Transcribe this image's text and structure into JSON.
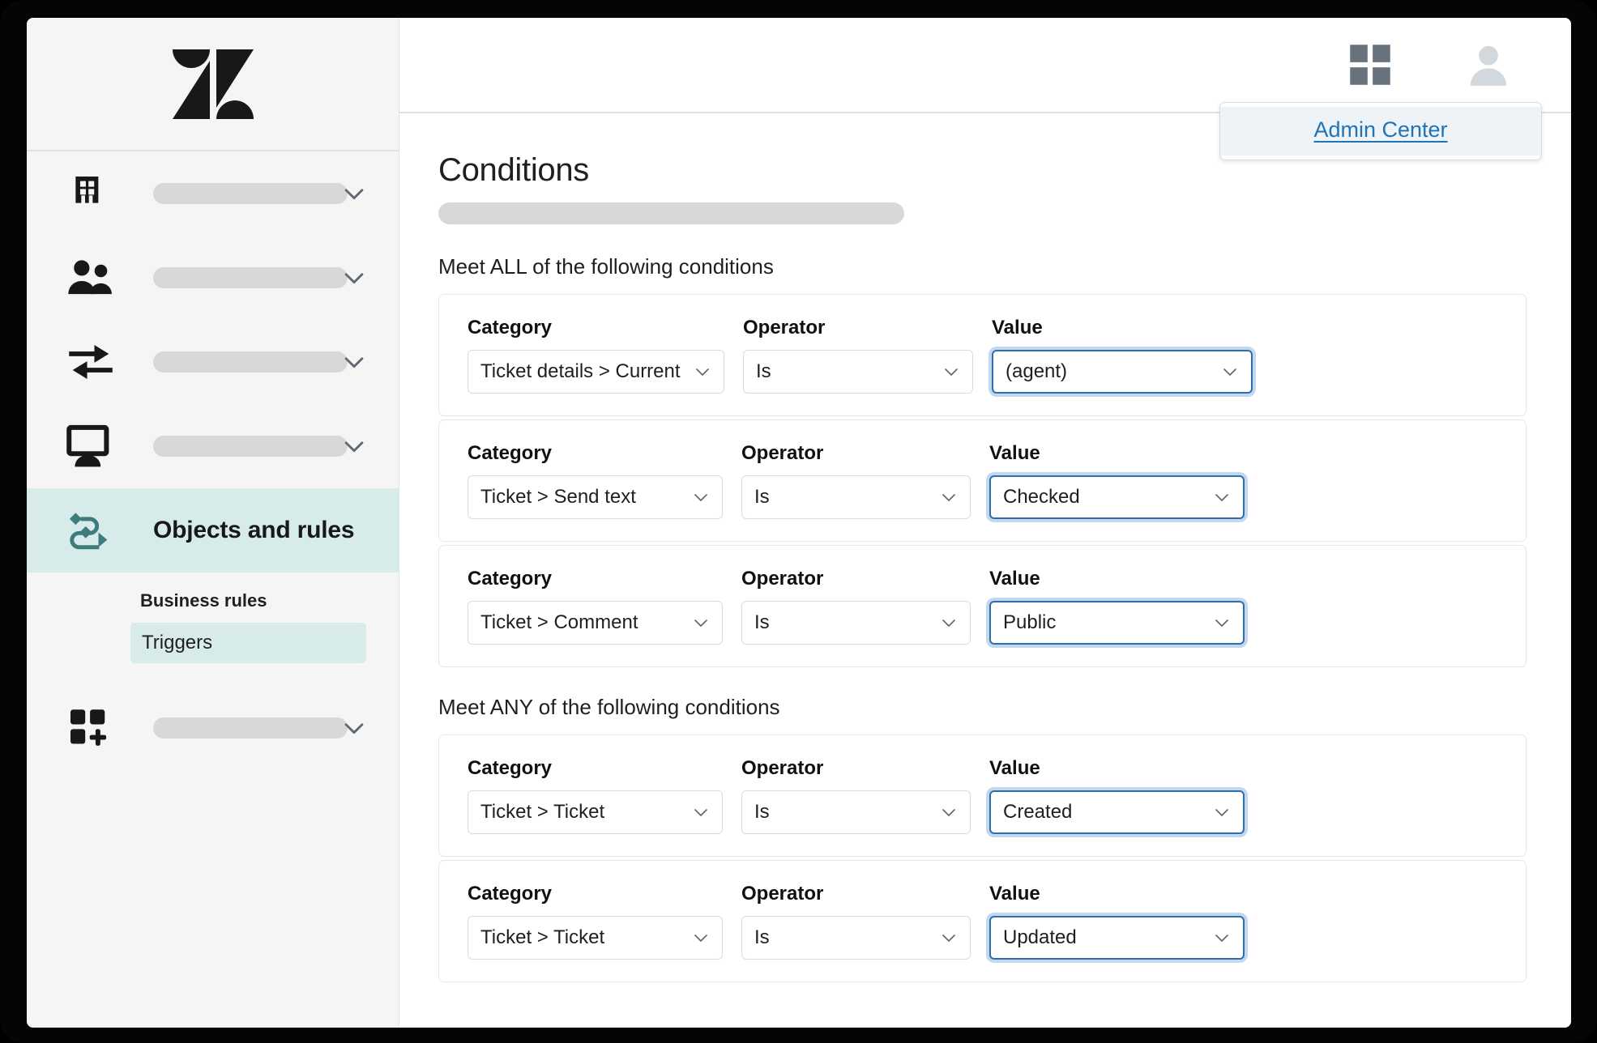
{
  "sidebar": {
    "logo_name": "zendesk-logo",
    "nav_groups": [
      {
        "icon": "building-icon",
        "label": "",
        "chevron": "chevron-down-icon"
      },
      {
        "icon": "people-icon",
        "label": "",
        "chevron": "chevron-down-icon"
      },
      {
        "icon": "channels-arrows-icon",
        "label": "",
        "chevron": "chevron-down-icon"
      },
      {
        "icon": "workspace-monitor-icon",
        "label": "",
        "chevron": "chevron-down-icon"
      }
    ],
    "active_group": {
      "icon": "objects-rules-icon",
      "label": "Objects and rules"
    },
    "sub_header": "Business rules",
    "sub_items": [
      {
        "label": "Triggers",
        "selected": true
      }
    ],
    "apps_group": {
      "icon": "apps-plus-icon",
      "label": "",
      "chevron": "chevron-down-icon"
    }
  },
  "topbar": {
    "products_icon": "products-grid-icon",
    "avatar_icon": "user-avatar-icon",
    "dropdown": {
      "items": [
        {
          "label": "Admin Center",
          "highlighted": true
        }
      ]
    }
  },
  "main": {
    "page_title": "Conditions",
    "group_all_label": "Meet ALL of the following conditions",
    "group_any_label": "Meet ANY of the following conditions",
    "field_labels": {
      "category": "Category",
      "operator": "Operator",
      "value": "Value"
    },
    "conditions_all": [
      {
        "category": "Ticket details > Current user",
        "operator": "Is",
        "value": "(agent)",
        "value_focused": true
      },
      {
        "category": "Ticket > Send text",
        "operator": "Is",
        "value": "Checked",
        "value_focused": true
      },
      {
        "category": "Ticket > Comment",
        "operator": "Is",
        "value": "Public",
        "value_focused": true
      }
    ],
    "conditions_any": [
      {
        "category": "Ticket > Ticket",
        "operator": "Is",
        "value": "Created",
        "value_focused": true
      },
      {
        "category": "Ticket > Ticket",
        "operator": "Is",
        "value": "Updated",
        "value_focused": true
      }
    ]
  },
  "colors": {
    "accent_teal": "#d7ecea",
    "link_blue": "#1f73b7",
    "focus_blue": "#2f6eab",
    "sidebar_bg": "#f5f5f5",
    "skeleton": "#d8d8d8"
  }
}
